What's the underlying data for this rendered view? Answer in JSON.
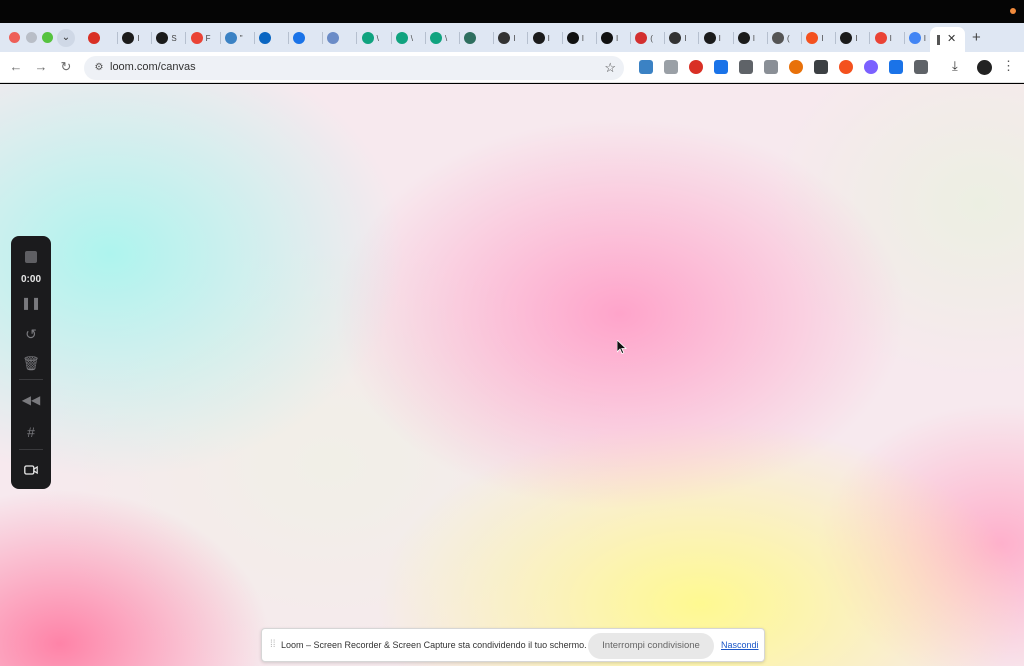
{
  "browser": {
    "tabs": [
      {
        "icon": "record-icon",
        "text": "",
        "color": "#d93025"
      },
      {
        "icon": "avatar-icon",
        "text": "I",
        "color": "#1b1b1b"
      },
      {
        "icon": "avatar-icon",
        "text": "S",
        "color": "#1b1b1b"
      },
      {
        "icon": "gmail-icon",
        "text": "F",
        "color": "#ea4335"
      },
      {
        "icon": "cloud-icon",
        "text": "\"",
        "color": "#3b82c4"
      },
      {
        "icon": "linkedin-icon",
        "text": "",
        "color": "#0a66c2"
      },
      {
        "icon": "compass-icon",
        "text": "",
        "color": "#1a73e8"
      },
      {
        "icon": "rainbow-icon",
        "text": "",
        "color": "#6b8cc7"
      },
      {
        "icon": "chatgpt-icon",
        "text": "\\",
        "color": "#10a37f"
      },
      {
        "icon": "chatgpt-icon",
        "text": "\\",
        "color": "#10a37f"
      },
      {
        "icon": "chatgpt-icon",
        "text": "\\",
        "color": "#10a37f"
      },
      {
        "icon": "search-zoom-icon",
        "text": "",
        "color": "#2f6f5f"
      },
      {
        "icon": "chat-icon",
        "text": "I",
        "color": "#333333"
      },
      {
        "icon": "avatar-icon",
        "text": "I",
        "color": "#1b1b1b"
      },
      {
        "icon": "activity-icon",
        "text": "I",
        "color": "#111111"
      },
      {
        "icon": "notion-icon",
        "text": "I",
        "color": "#111111"
      },
      {
        "icon": "sk-icon",
        "text": "(",
        "color": "#d32f2f"
      },
      {
        "icon": "chat-icon",
        "text": "I",
        "color": "#333333"
      },
      {
        "icon": "avatar-icon",
        "text": "I",
        "color": "#1b1b1b"
      },
      {
        "icon": "avatar-icon",
        "text": "I",
        "color": "#1b1b1b"
      },
      {
        "icon": "globe-icon",
        "text": "(",
        "color": "#555555"
      },
      {
        "icon": "orange-app-icon",
        "text": "I",
        "color": "#f4511e"
      },
      {
        "icon": "avatar-icon",
        "text": "I",
        "color": "#1b1b1b"
      },
      {
        "icon": "gmail-icon",
        "text": "I",
        "color": "#ea4335"
      },
      {
        "icon": "docs-icon",
        "text": "I",
        "color": "#4285f4"
      }
    ],
    "active_tab_text": "I",
    "new_tab_label": "+",
    "close_tab_label": "✕",
    "url": "loom.com/canvas"
  },
  "loom_panel": {
    "timer": "0:00"
  },
  "share_bar": {
    "grip": "⁞⁞",
    "message": "Loom – Screen Recorder & Screen Capture sta condividendo il tuo schermo.",
    "stop_label": "Interrompi condivisione",
    "hide_label": "Nascondi"
  }
}
